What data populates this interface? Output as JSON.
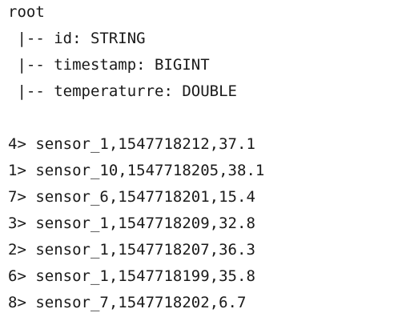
{
  "schema": {
    "root": "root",
    "fields": [
      {
        "prefix": " |-- ",
        "text": "id: STRING"
      },
      {
        "prefix": " |-- ",
        "text": "timestamp: BIGINT"
      },
      {
        "prefix": " |-- ",
        "text": "temperaturre: DOUBLE"
      }
    ]
  },
  "output": [
    {
      "partition": "4>",
      "record": "sensor_1,1547718212,37.1"
    },
    {
      "partition": "1>",
      "record": "sensor_10,1547718205,38.1"
    },
    {
      "partition": "7>",
      "record": "sensor_6,1547718201,15.4"
    },
    {
      "partition": "3>",
      "record": "sensor_1,1547718209,32.8"
    },
    {
      "partition": "2>",
      "record": "sensor_1,1547718207,36.3"
    },
    {
      "partition": "6>",
      "record": "sensor_1,1547718199,35.8"
    },
    {
      "partition": "8>",
      "record": "sensor_7,1547718202,6.7"
    }
  ]
}
